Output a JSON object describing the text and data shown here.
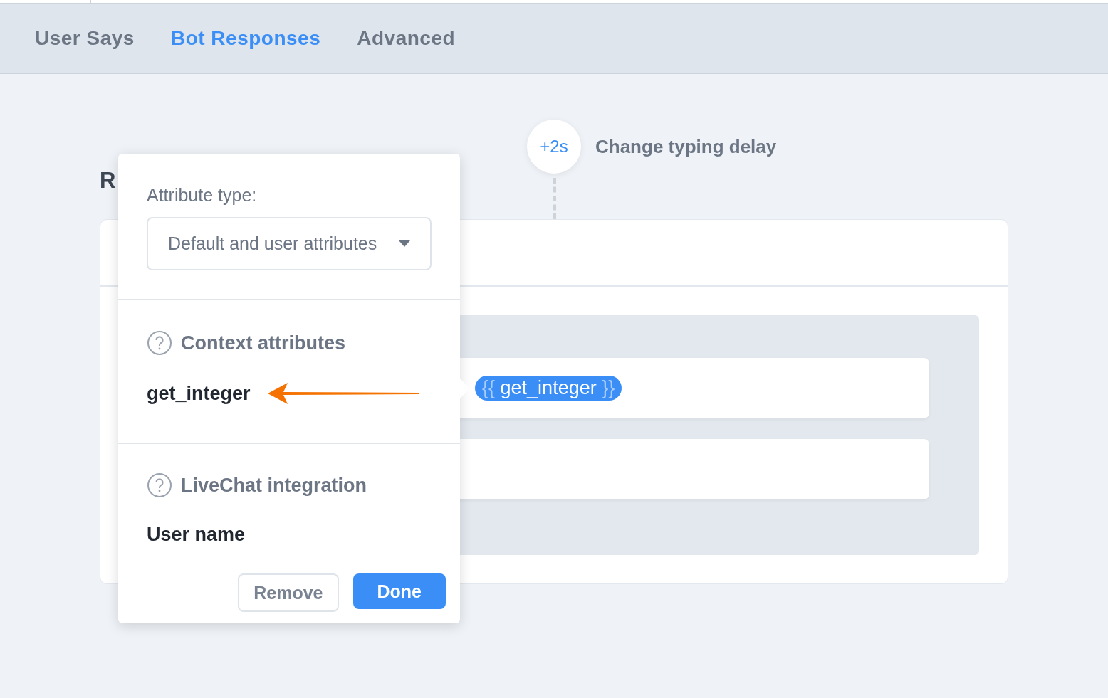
{
  "tabs": [
    {
      "label": "User Says",
      "selected": false
    },
    {
      "label": "Bot Responses",
      "selected": true
    },
    {
      "label": "Advanced",
      "selected": false
    }
  ],
  "typing_delay": {
    "badge": "+2s",
    "label": "Change typing delay"
  },
  "card": {
    "title": "R",
    "bubbles": [
      {
        "kind": "chip",
        "chip_open": "{{",
        "chip_text": "get_integer",
        "chip_close": "}}"
      },
      {
        "kind": "empty"
      }
    ]
  },
  "popup": {
    "attribute_type_label": "Attribute type:",
    "attribute_type_value": "Default and user attributes",
    "sections": [
      {
        "title": "Context attributes",
        "items": [
          "get_integer"
        ]
      },
      {
        "title": "LiveChat integration",
        "items": [
          "User name"
        ]
      }
    ],
    "buttons": [
      {
        "label": "Remove",
        "kind": "secondary"
      },
      {
        "label": "Done",
        "kind": "primary"
      }
    ]
  }
}
